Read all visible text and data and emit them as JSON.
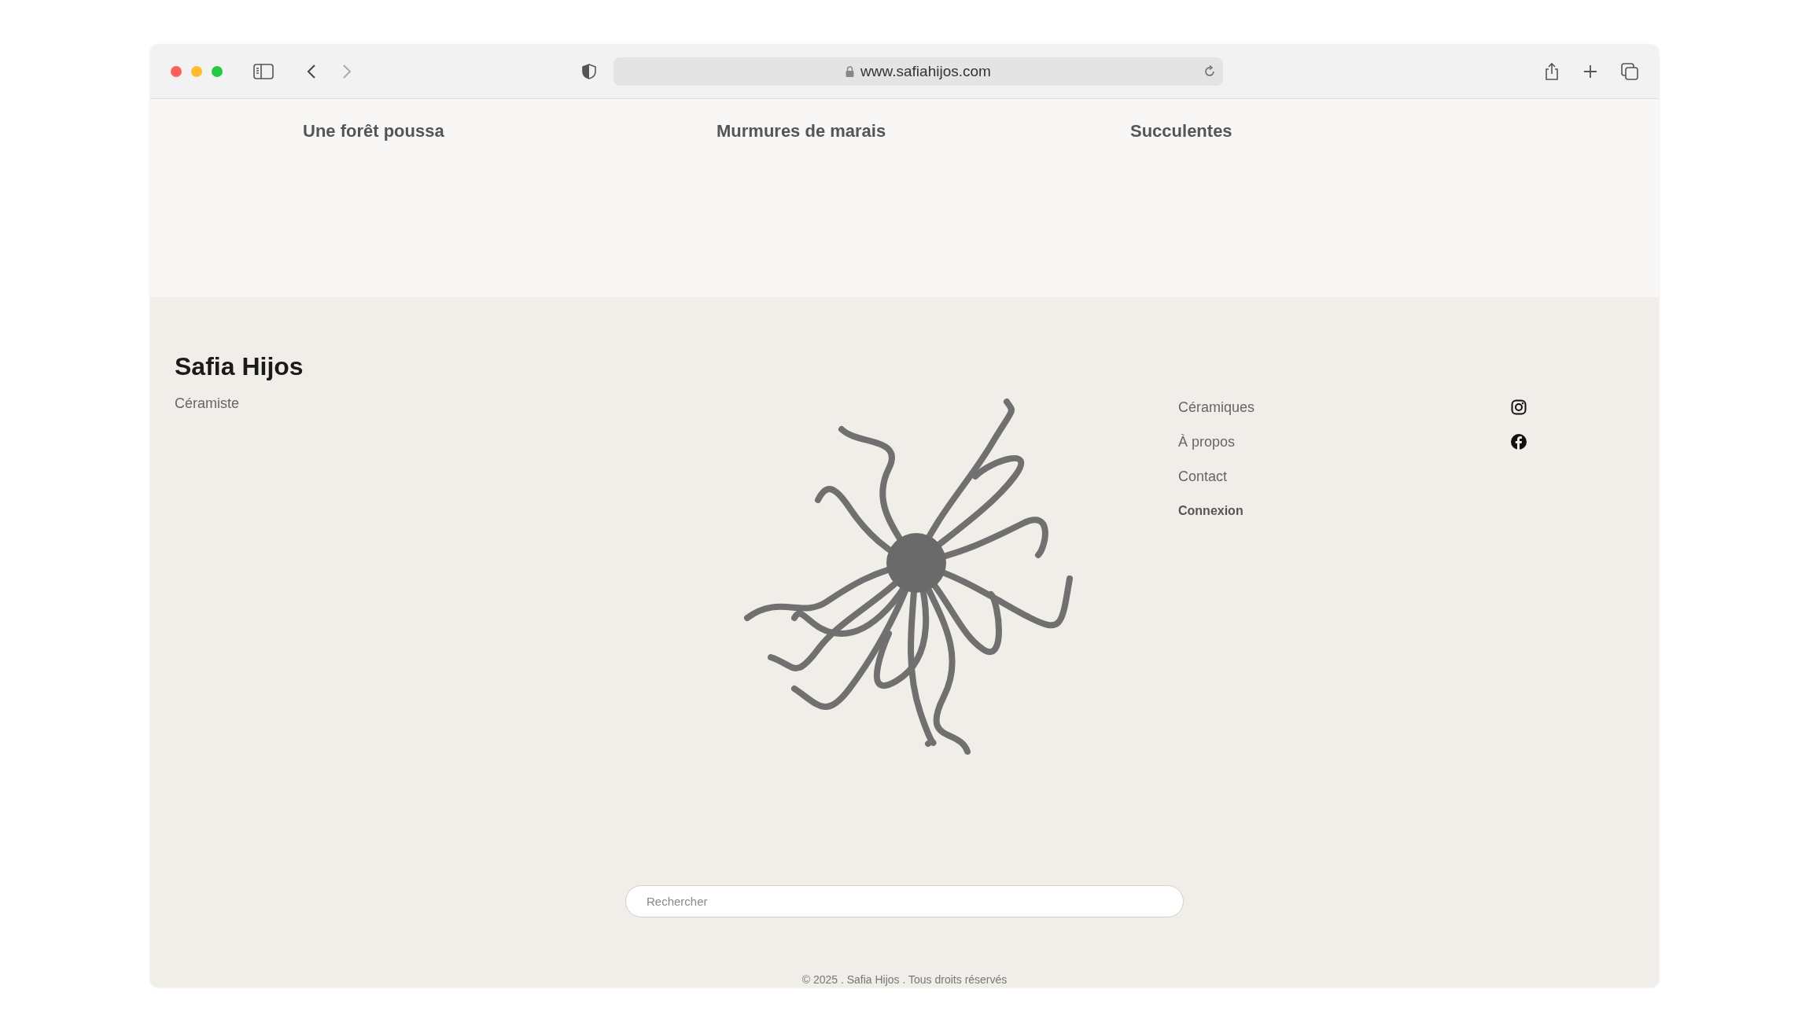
{
  "browser": {
    "url": "www.safiahijos.com"
  },
  "gallery": {
    "titles": [
      "Une forêt poussa",
      "Murmures de marais",
      "Succulentes"
    ]
  },
  "footer": {
    "name": "Safia Hijos",
    "tagline": "Céramiste",
    "links": [
      {
        "label": "Céramiques",
        "bold": false
      },
      {
        "label": "À propos",
        "bold": false
      },
      {
        "label": "Contact",
        "bold": false
      },
      {
        "label": "Connexion",
        "bold": true
      }
    ],
    "social": [
      {
        "kind": "instagram"
      },
      {
        "kind": "facebook"
      }
    ],
    "search": {
      "placeholder": "Rechercher"
    },
    "copyright": "© 2025 . Safia Hijos . Tous droits réservés"
  }
}
